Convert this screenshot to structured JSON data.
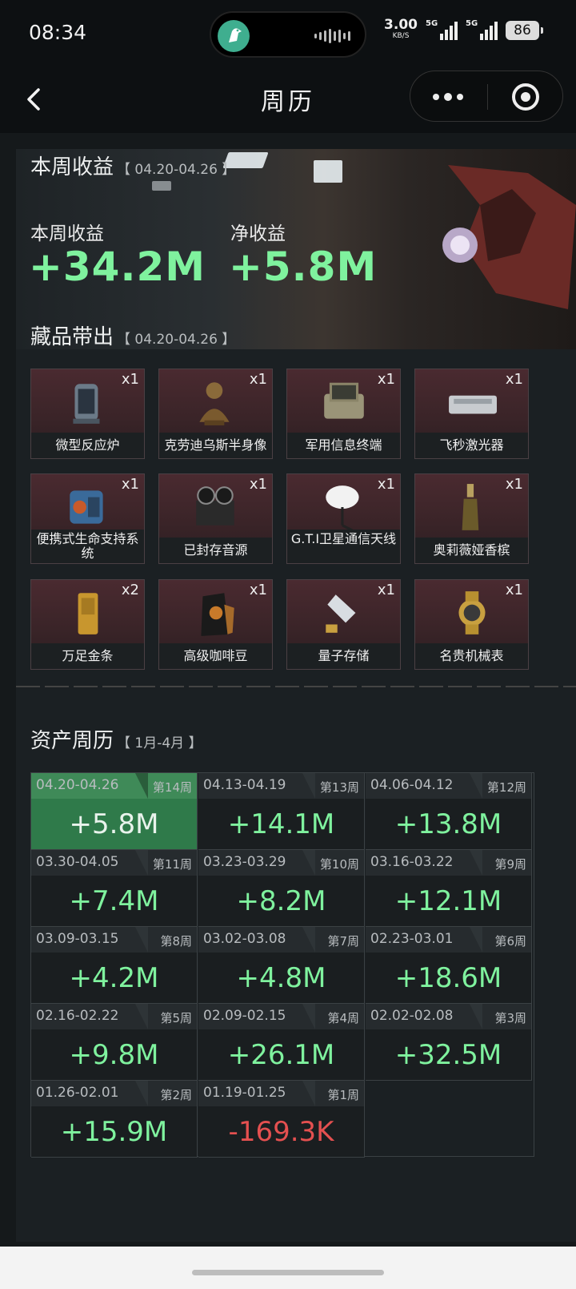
{
  "status_bar": {
    "time": "08:34",
    "net_speed": "3.00",
    "net_unit": "KB/S",
    "sim1": "5G",
    "sim2": "5G",
    "battery": "86"
  },
  "nav": {
    "title": "周历",
    "back_icon": "chevron-left-icon",
    "more_icon": "more-dots-icon",
    "close_icon": "target-icon"
  },
  "week_summary": {
    "title": "本周收益",
    "range": "【 04.20-04.26 】",
    "income_label": "本周收益",
    "income_value": "+34.2M",
    "net_label": "净收益",
    "net_value": "+5.8M"
  },
  "collectibles": {
    "title": "藏品带出",
    "range": "【 04.20-04.26 】",
    "items": [
      {
        "name": "微型反应炉",
        "count": "x1"
      },
      {
        "name": "克劳迪乌斯半身像",
        "count": "x1"
      },
      {
        "name": "军用信息终端",
        "count": "x1"
      },
      {
        "name": "飞秒激光器",
        "count": "x1"
      },
      {
        "name": "便携式生命支持系统",
        "count": "x1"
      },
      {
        "name": "已封存音源",
        "count": "x1"
      },
      {
        "name": "G.T.I卫星通信天线",
        "count": "x1"
      },
      {
        "name": "奥莉薇娅香槟",
        "count": "x1"
      },
      {
        "name": "万足金条",
        "count": "x2"
      },
      {
        "name": "高级咖啡豆",
        "count": "x1"
      },
      {
        "name": "量子存储",
        "count": "x1"
      },
      {
        "name": "名贵机械表",
        "count": "x1"
      }
    ]
  },
  "asset_calendar": {
    "title": "资产周历",
    "range": "【 1月-4月 】",
    "weeks": [
      {
        "dates": "04.20-04.26",
        "week": "第14周",
        "value": "+5.8M"
      },
      {
        "dates": "04.13-04.19",
        "week": "第13周",
        "value": "+14.1M"
      },
      {
        "dates": "04.06-04.12",
        "week": "第12周",
        "value": "+13.8M"
      },
      {
        "dates": "03.30-04.05",
        "week": "第11周",
        "value": "+7.4M"
      },
      {
        "dates": "03.23-03.29",
        "week": "第10周",
        "value": "+8.2M"
      },
      {
        "dates": "03.16-03.22",
        "week": "第9周",
        "value": "+12.1M"
      },
      {
        "dates": "03.09-03.15",
        "week": "第8周",
        "value": "+4.2M"
      },
      {
        "dates": "03.02-03.08",
        "week": "第7周",
        "value": "+4.8M"
      },
      {
        "dates": "02.23-03.01",
        "week": "第6周",
        "value": "+18.6M"
      },
      {
        "dates": "02.16-02.22",
        "week": "第5周",
        "value": "+9.8M"
      },
      {
        "dates": "02.09-02.15",
        "week": "第4周",
        "value": "+26.1M"
      },
      {
        "dates": "02.02-02.08",
        "week": "第3周",
        "value": "+32.5M"
      },
      {
        "dates": "01.26-02.01",
        "week": "第2周",
        "value": "+15.9M"
      },
      {
        "dates": "01.19-01.25",
        "week": "第1周",
        "value": "-169.3K"
      }
    ]
  },
  "colors": {
    "positive": "#7ff29e",
    "negative": "#e45050",
    "current_week": "#2f7a4a"
  }
}
